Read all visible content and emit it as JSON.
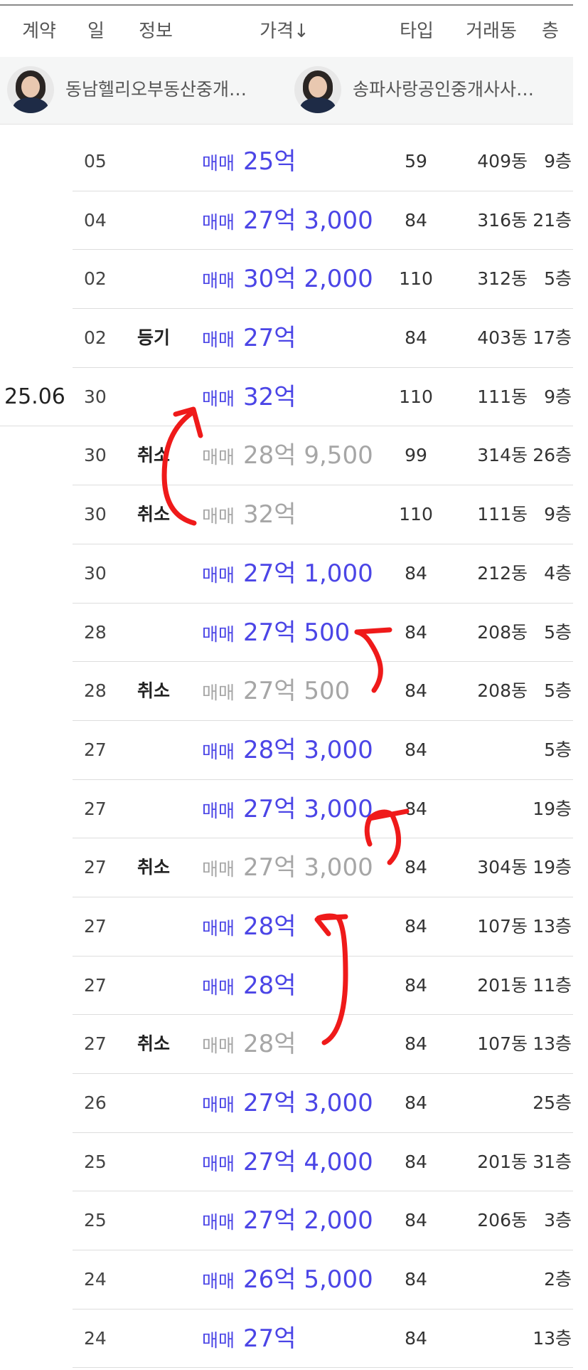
{
  "header": {
    "contract": "계약",
    "day": "일",
    "info": "정보",
    "price": "가격↓",
    "type": "타입",
    "dong": "거래동",
    "floor": "층"
  },
  "brokers": [
    {
      "name": "동남헬리오부동산중개…",
      "avatar": "woman-portrait"
    },
    {
      "name": "송파사랑공인중개사사…",
      "avatar": "woman-portrait"
    }
  ],
  "rows": [
    {
      "contract": "",
      "day": "05",
      "info": "",
      "deal": "매매",
      "price": "25억",
      "type": "59",
      "dong": "409동",
      "floor": "9층",
      "cancelled": false
    },
    {
      "contract": "",
      "day": "04",
      "info": "",
      "deal": "매매",
      "price": "27억 3,000",
      "type": "84",
      "dong": "316동",
      "floor": "21층",
      "cancelled": false
    },
    {
      "contract": "",
      "day": "02",
      "info": "",
      "deal": "매매",
      "price": "30억 2,000",
      "type": "110",
      "dong": "312동",
      "floor": "5층",
      "cancelled": false
    },
    {
      "contract": "",
      "day": "02",
      "info": "등기",
      "deal": "매매",
      "price": "27억",
      "type": "84",
      "dong": "403동",
      "floor": "17층",
      "cancelled": false
    },
    {
      "contract": "25.06",
      "day": "30",
      "info": "",
      "deal": "매매",
      "price": "32억",
      "type": "110",
      "dong": "111동",
      "floor": "9층",
      "cancelled": false
    },
    {
      "contract": "",
      "day": "30",
      "info": "취소",
      "deal": "매매",
      "price": "28억 9,500",
      "type": "99",
      "dong": "314동",
      "floor": "26층",
      "cancelled": true
    },
    {
      "contract": "",
      "day": "30",
      "info": "취소",
      "deal": "매매",
      "price": "32억",
      "type": "110",
      "dong": "111동",
      "floor": "9층",
      "cancelled": true
    },
    {
      "contract": "",
      "day": "30",
      "info": "",
      "deal": "매매",
      "price": "27억 1,000",
      "type": "84",
      "dong": "212동",
      "floor": "4층",
      "cancelled": false
    },
    {
      "contract": "",
      "day": "28",
      "info": "",
      "deal": "매매",
      "price": "27억 500",
      "type": "84",
      "dong": "208동",
      "floor": "5층",
      "cancelled": false
    },
    {
      "contract": "",
      "day": "28",
      "info": "취소",
      "deal": "매매",
      "price": "27억 500",
      "type": "84",
      "dong": "208동",
      "floor": "5층",
      "cancelled": true
    },
    {
      "contract": "",
      "day": "27",
      "info": "",
      "deal": "매매",
      "price": "28억 3,000",
      "type": "84",
      "dong": "",
      "floor": "5층",
      "cancelled": false
    },
    {
      "contract": "",
      "day": "27",
      "info": "",
      "deal": "매매",
      "price": "27억 3,000",
      "type": "84",
      "dong": "",
      "floor": "19층",
      "cancelled": false
    },
    {
      "contract": "",
      "day": "27",
      "info": "취소",
      "deal": "매매",
      "price": "27억 3,000",
      "type": "84",
      "dong": "304동",
      "floor": "19층",
      "cancelled": true
    },
    {
      "contract": "",
      "day": "27",
      "info": "",
      "deal": "매매",
      "price": "28억",
      "type": "84",
      "dong": "107동",
      "floor": "13층",
      "cancelled": false
    },
    {
      "contract": "",
      "day": "27",
      "info": "",
      "deal": "매매",
      "price": "28억",
      "type": "84",
      "dong": "201동",
      "floor": "11층",
      "cancelled": false
    },
    {
      "contract": "",
      "day": "27",
      "info": "취소",
      "deal": "매매",
      "price": "28억",
      "type": "84",
      "dong": "107동",
      "floor": "13층",
      "cancelled": true
    },
    {
      "contract": "",
      "day": "26",
      "info": "",
      "deal": "매매",
      "price": "27억 3,000",
      "type": "84",
      "dong": "",
      "floor": "25층",
      "cancelled": false
    },
    {
      "contract": "",
      "day": "25",
      "info": "",
      "deal": "매매",
      "price": "27억 4,000",
      "type": "84",
      "dong": "201동",
      "floor": "31층",
      "cancelled": false
    },
    {
      "contract": "",
      "day": "25",
      "info": "",
      "deal": "매매",
      "price": "27억 2,000",
      "type": "84",
      "dong": "206동",
      "floor": "3층",
      "cancelled": false
    },
    {
      "contract": "",
      "day": "24",
      "info": "",
      "deal": "매매",
      "price": "26억 5,000",
      "type": "84",
      "dong": "",
      "floor": "2층",
      "cancelled": false
    },
    {
      "contract": "",
      "day": "24",
      "info": "",
      "deal": "매매",
      "price": "27억",
      "type": "84",
      "dong": "",
      "floor": "13층",
      "cancelled": false
    }
  ],
  "colors": {
    "price_active": "#4b45e6",
    "price_cancelled": "#a6a6a6",
    "annotation": "#ef1a1a"
  }
}
